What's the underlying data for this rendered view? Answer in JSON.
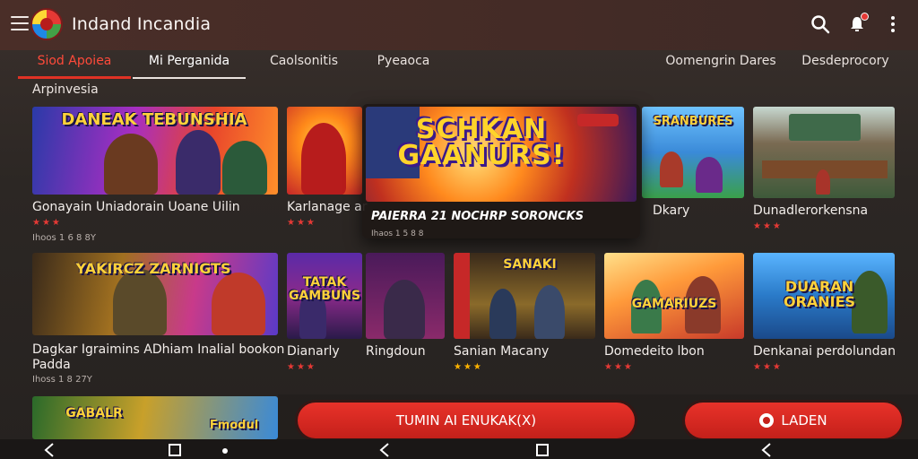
{
  "header": {
    "title": "Indand Incandia",
    "menu_icon": "hamburger-menu-icon",
    "search_icon": "search-icon",
    "notification_icon": "bell-icon",
    "more_icon": "more-vertical-icon"
  },
  "tabs": [
    {
      "label": "Siod Apoiea"
    },
    {
      "label": "Mi Perganida"
    },
    {
      "label": "Caolsonitis"
    },
    {
      "label": "Pyeaoca"
    },
    {
      "label": "Oomengrin Dares"
    },
    {
      "label": "Desdeprocory"
    }
  ],
  "section": {
    "label": "Arpinvesia"
  },
  "row1": [
    {
      "title": "Gonayain Uniadorain Uoane Uilin",
      "stars": "★★★",
      "meta": "Ihoos 1 6 8 8Y",
      "art": "DANEAK  TEBUNSHIA"
    },
    {
      "title": "Karlanage ar",
      "stars": "★★★",
      "meta": "",
      "art": ""
    },
    {
      "title": "Dkary",
      "stars": "",
      "meta": "",
      "art": "SRANBURES"
    },
    {
      "title": "Dunadlerorkensna",
      "stars": "★★★",
      "meta": "",
      "art": ""
    }
  ],
  "feature": {
    "art_title": "SCHKAN GAANURS!",
    "caption": "PAIERRA 21 NOCHRP SORONCKS",
    "stars": "★★★",
    "meta": "Ihaos 1 5 8 8"
  },
  "row2": [
    {
      "title": "Dagkar Igraimins ADhiam Inalial bookon",
      "title2": "Padda",
      "stars": "",
      "meta": "Ihoss 1 8 27Y",
      "art": "YAKIRCZ  ZARNIGTS"
    },
    {
      "title": "Dianarly",
      "stars": "★★★",
      "meta": "",
      "art": "TATAK GAMBUNS"
    },
    {
      "title": "Ringdoun",
      "stars": "",
      "meta": "",
      "art": ""
    },
    {
      "title": "Sanian Macany",
      "stars": "★★★",
      "meta": "",
      "art": "SANAKI"
    },
    {
      "title": "Domedeito lbon",
      "stars": "★★★",
      "meta": "",
      "art": "GAMARIUZS"
    },
    {
      "title": "Denkanai perdolundan",
      "stars": "★★★",
      "meta": "",
      "art": "DUARAN ORANIES"
    }
  ],
  "row3": [
    {
      "art": "GABALR"
    },
    {
      "art": "Fmodul"
    }
  ],
  "buttons": {
    "primary": "TUMIN AI ENUKAK(X)",
    "secondary": "LADEN"
  },
  "nav": {
    "back_icon": "back-icon",
    "home_icon": "home-square-icon"
  },
  "colors": {
    "accent": "#e03225",
    "header_bg": "#4a2e28",
    "background": "#2c2724"
  }
}
